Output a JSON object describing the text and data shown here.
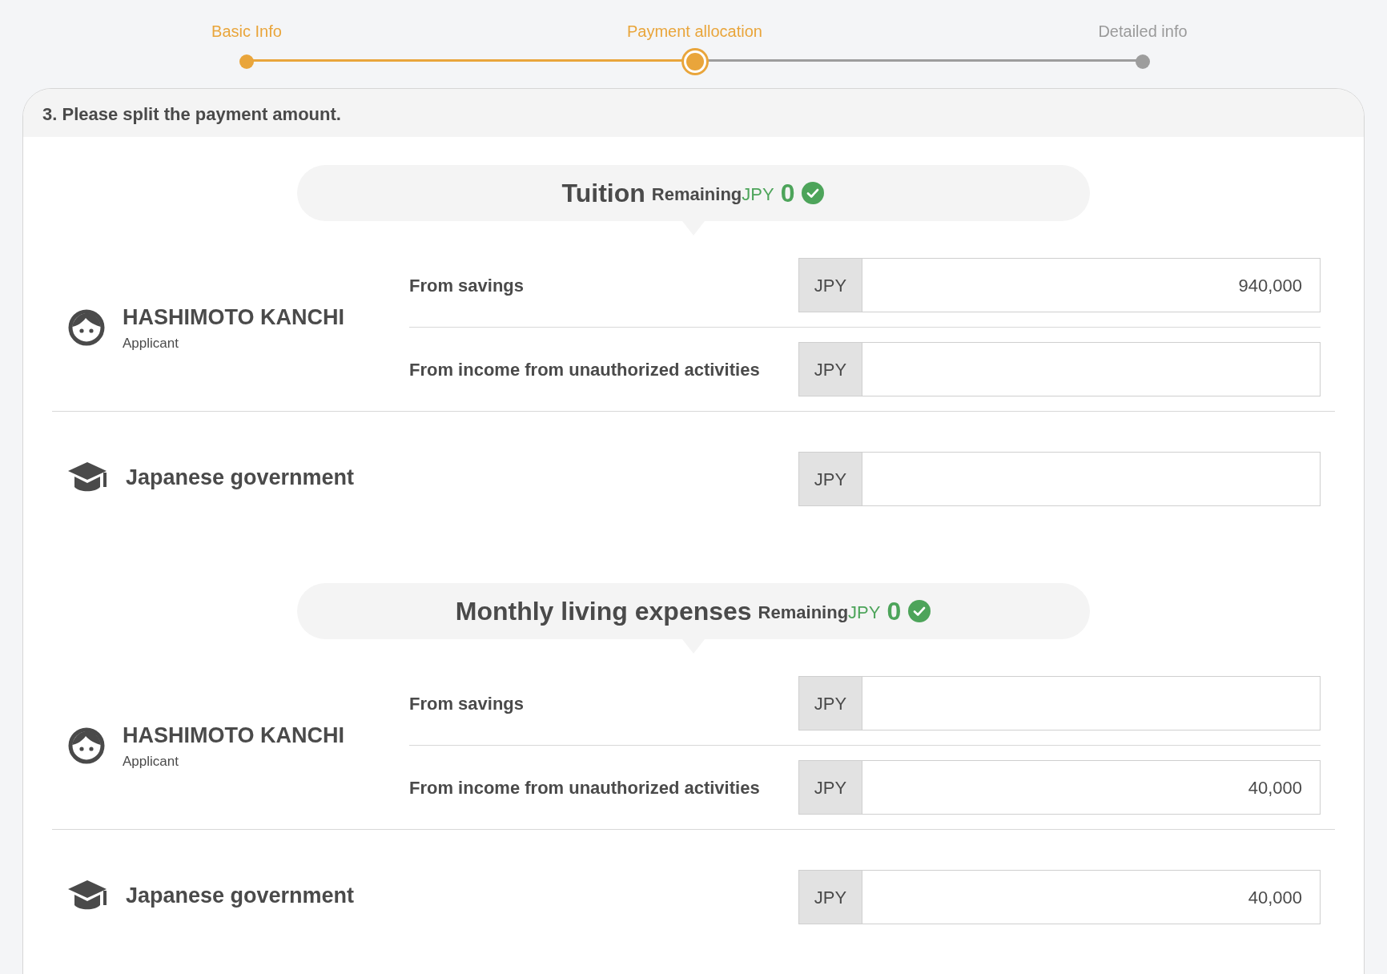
{
  "steps": [
    {
      "label": "Basic Info",
      "completed": true,
      "selected": false
    },
    {
      "label": "Payment allocation",
      "completed": false,
      "selected": true
    },
    {
      "label": "Detailed info",
      "completed": false,
      "selected": false
    }
  ],
  "card": {
    "title": "3. Please split the payment amount."
  },
  "sections": [
    {
      "title": "Tuition",
      "remaining_label": "Remaining",
      "currency": "JPY",
      "remaining": "0",
      "complete": true,
      "payers": [
        {
          "kind": "person",
          "name": "HASHIMOTO KANCHI",
          "role": "Applicant",
          "sources": [
            {
              "label": "From savings",
              "currency": "JPY",
              "value": "940,000"
            },
            {
              "label": "From income from unauthorized activities",
              "currency": "JPY"
            }
          ]
        },
        {
          "kind": "government",
          "name": "Japanese government",
          "sources": [
            {
              "currency": "JPY"
            }
          ]
        }
      ]
    },
    {
      "title": "Monthly living expenses",
      "remaining_label": "Remaining",
      "currency": "JPY",
      "remaining": "0",
      "complete": true,
      "payers": [
        {
          "kind": "person",
          "name": "HASHIMOTO KANCHI",
          "role": "Applicant",
          "sources": [
            {
              "label": "From savings",
              "currency": "JPY"
            },
            {
              "label": "From income from unauthorized activities",
              "currency": "JPY",
              "value": "40,000"
            }
          ]
        },
        {
          "kind": "government",
          "name": "Japanese government",
          "sources": [
            {
              "currency": "JPY",
              "value": "40,000"
            }
          ]
        }
      ]
    }
  ]
}
